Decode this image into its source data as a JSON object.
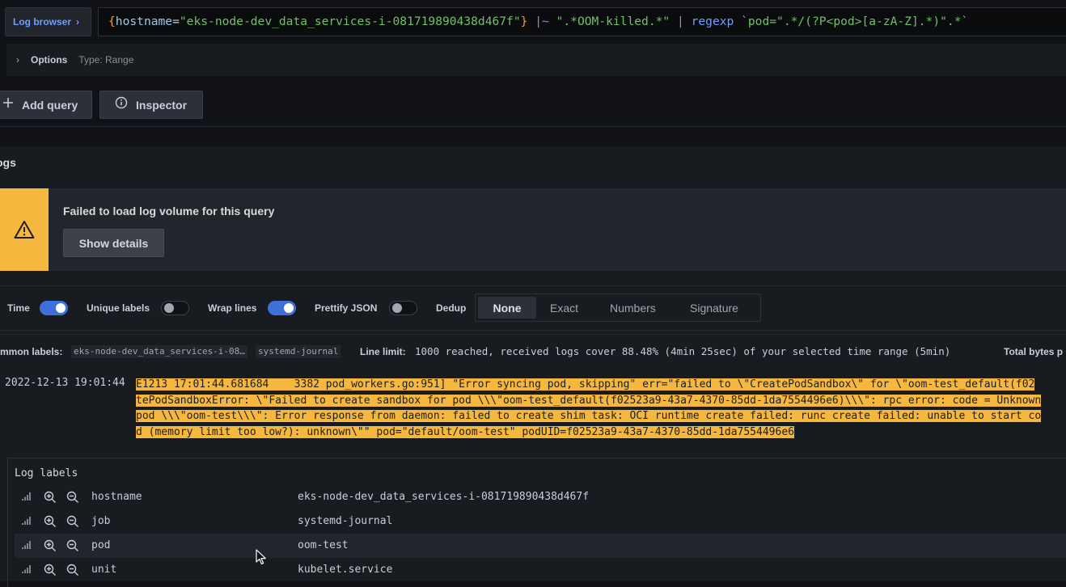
{
  "query": {
    "log_browser_label": "Log browser",
    "brace_open": "{",
    "label_key": "hostname",
    "eq": "=",
    "label_value": "\"eks-node-dev_data_services-i-081719890438d467f\"",
    "brace_close": "}",
    "filter_op": "|~",
    "filter_value": "\".*OOM-killed.*\"",
    "pipe": "|",
    "regexp_fn": "regexp",
    "regexp_value": "`pod=\".*/(?P<pod>[a-zA-Z].*)\".*`",
    "options_label": "Options",
    "options_type": "Type: Range",
    "add_query_label": "Add query",
    "inspector_label": "Inspector"
  },
  "logs": {
    "title": "ogs",
    "alert_title": "Failed to load log volume for this query",
    "show_details_label": "Show details",
    "alert_color": "#f5b73d"
  },
  "toolbar": {
    "time_label": "Time",
    "time_on": true,
    "unique_labels_label": "Unique labels",
    "unique_labels_on": false,
    "wrap_lines_label": "Wrap lines",
    "wrap_lines_on": true,
    "prettify_json_label": "Prettify JSON",
    "prettify_json_on": false,
    "dedup_label": "Dedup",
    "dedup_options": [
      "None",
      "Exact",
      "Numbers",
      "Signature"
    ],
    "dedup_selected": "None"
  },
  "meta": {
    "common_labels_key": "mmon labels:",
    "common_label_chips": [
      "eks-node-dev_data_services-i-08…",
      "systemd-journal"
    ],
    "line_limit_key": "Line limit:",
    "line_limit_value": "1000 reached, received logs cover 88.48% (4min 25sec) of your selected time range (5min)",
    "total_bytes_key": "Total bytes p"
  },
  "log_entry": {
    "timestamp": "2022-12-13 19:01:44",
    "lines": [
      "E1213 17:01:44.681684    3382 pod_workers.go:951] \"Error syncing pod, skipping\" err=\"failed to \\\"CreatePodSandbox\\\" for \\\"oom-test_default(f02",
      "tePodSandboxError: \\\"Failed to create sandbox for pod \\\\\\\"oom-test_default(f02523a9-43a7-4370-85dd-1da7554496e6)\\\\\\\": rpc error: code = Unknown",
      "pod \\\\\\\"oom-test\\\\\\\": Error response from daemon: failed to create shim task: OCI runtime create failed: runc create failed: unable to start co",
      "d (memory limit too low?): unknown\\\"\" pod=\"default/oom-test\" podUID=f02523a9-43a7-4370-85dd-1da7554496e6"
    ],
    "highlight_color": "#f5b73d"
  },
  "details": {
    "title": "Log labels",
    "rows": [
      {
        "key": "hostname",
        "value": "eks-node-dev_data_services-i-081719890438d467f"
      },
      {
        "key": "job",
        "value": "systemd-journal"
      },
      {
        "key": "pod",
        "value": "oom-test"
      },
      {
        "key": "unit",
        "value": "kubelet.service"
      }
    ]
  },
  "icons": {
    "log_browser": "chevron-right-icon",
    "options": "chevron-right-icon",
    "add_query": "plus-icon",
    "inspector": "info-circle-icon",
    "alert": "warning-triangle-icon",
    "row_stats": "signal-bars-icon",
    "row_filter_for": "zoom-in-icon",
    "row_filter_out": "zoom-out-icon",
    "cursor": "mouse-pointer-icon"
  },
  "colors": {
    "accent": "#3d71d9",
    "link": "#6e9fff",
    "background": "#111217",
    "panel": "#181b1f"
  }
}
